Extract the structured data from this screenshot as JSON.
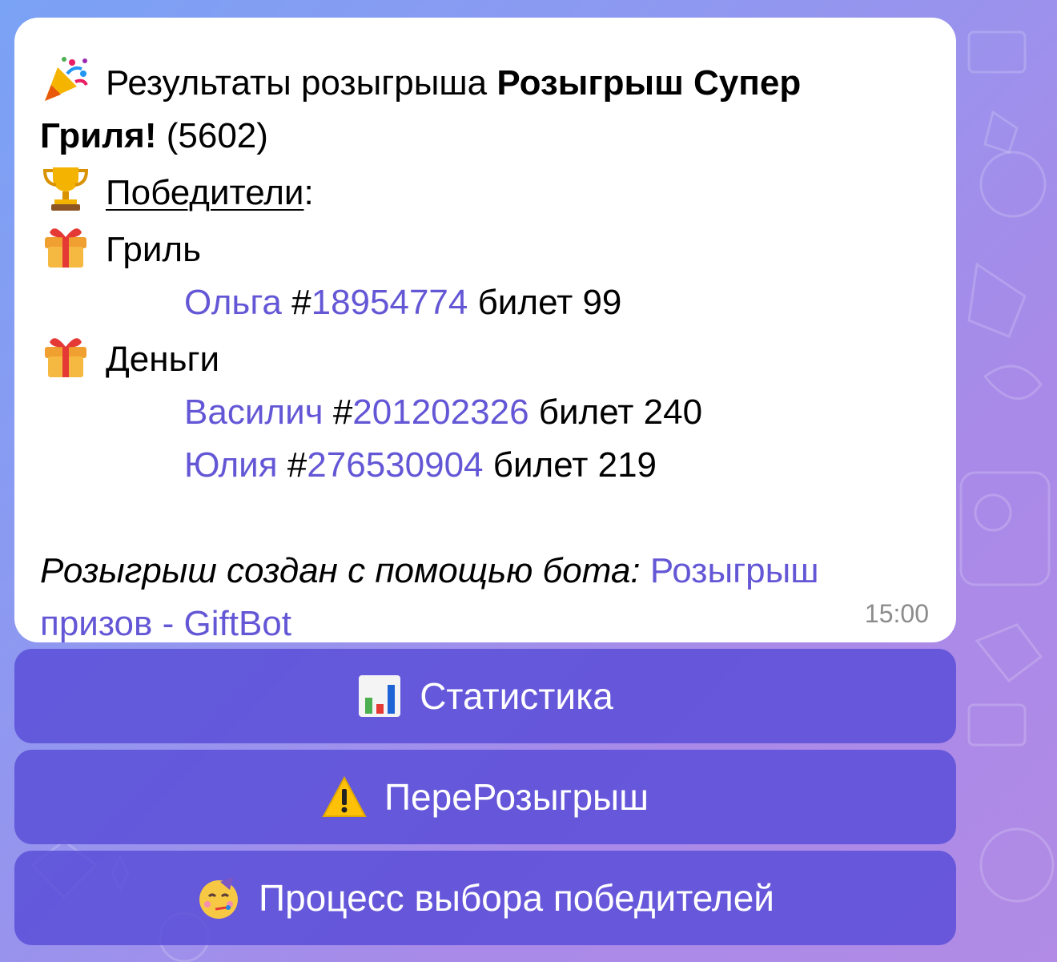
{
  "message": {
    "title_prefix": "Результаты розыгрыша",
    "title_bold": "Розыгрыш Супер",
    "title_bold_cont": "Гриля!",
    "title_id": "(5602)",
    "winners_label": "Победители",
    "winners_colon": ":",
    "prizes": [
      {
        "name": "Гриль",
        "winners": [
          {
            "name": "Ольга",
            "hash": "#",
            "id": "18954774",
            "ticket": "билет 99"
          }
        ]
      },
      {
        "name": "Деньги",
        "winners": [
          {
            "name": "Василич",
            "hash": "#",
            "id": "201202326",
            "ticket": "билет 240"
          },
          {
            "name": "Юлия",
            "hash": "#",
            "id": "276530904",
            "ticket": "билет 219"
          }
        ]
      }
    ],
    "footer_italic": "Розыгрыш создан с помощью бота:",
    "footer_link": "Розыгрыш призов - GiftBot",
    "time": "15:00"
  },
  "icons": {
    "title": "party-popper-icon",
    "winners": "trophy-icon",
    "prize": "gift-icon",
    "stats": "bar-chart-icon",
    "redraw": "warning-icon",
    "process": "partying-face-icon"
  },
  "buttons": {
    "stats": "Статистика",
    "redraw": "ПереРозыгрыш",
    "process": "Процесс выбора победителей"
  },
  "colors": {
    "link": "#6457d6",
    "button_bg": "#584cd7",
    "bubble_bg": "#ffffff"
  }
}
